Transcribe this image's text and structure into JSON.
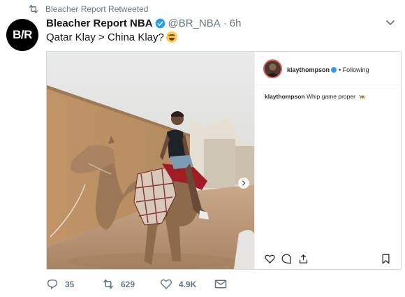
{
  "retweet": {
    "text": "Bleacher Report Retweeted",
    "icon": "retweet-icon"
  },
  "tweet": {
    "avatar_text": "B/R",
    "name": "Bleacher Report NBA",
    "handle": "@BR_NBA",
    "separator": "·",
    "time": "6h",
    "text": "Qatar Klay > China Klay?",
    "emoji": "face-with-tears-of-joy"
  },
  "instagram": {
    "username": "klaythompson",
    "follow_status": "• Following",
    "caption_user": "klaythompson",
    "caption_text": "Whip game proper"
  },
  "actions": {
    "replies": "35",
    "retweets": "629",
    "likes": "4.9K"
  },
  "colors": {
    "accent": "#1da1f2",
    "muted": "#657786",
    "text": "#14171a",
    "border": "#cfd9de"
  }
}
